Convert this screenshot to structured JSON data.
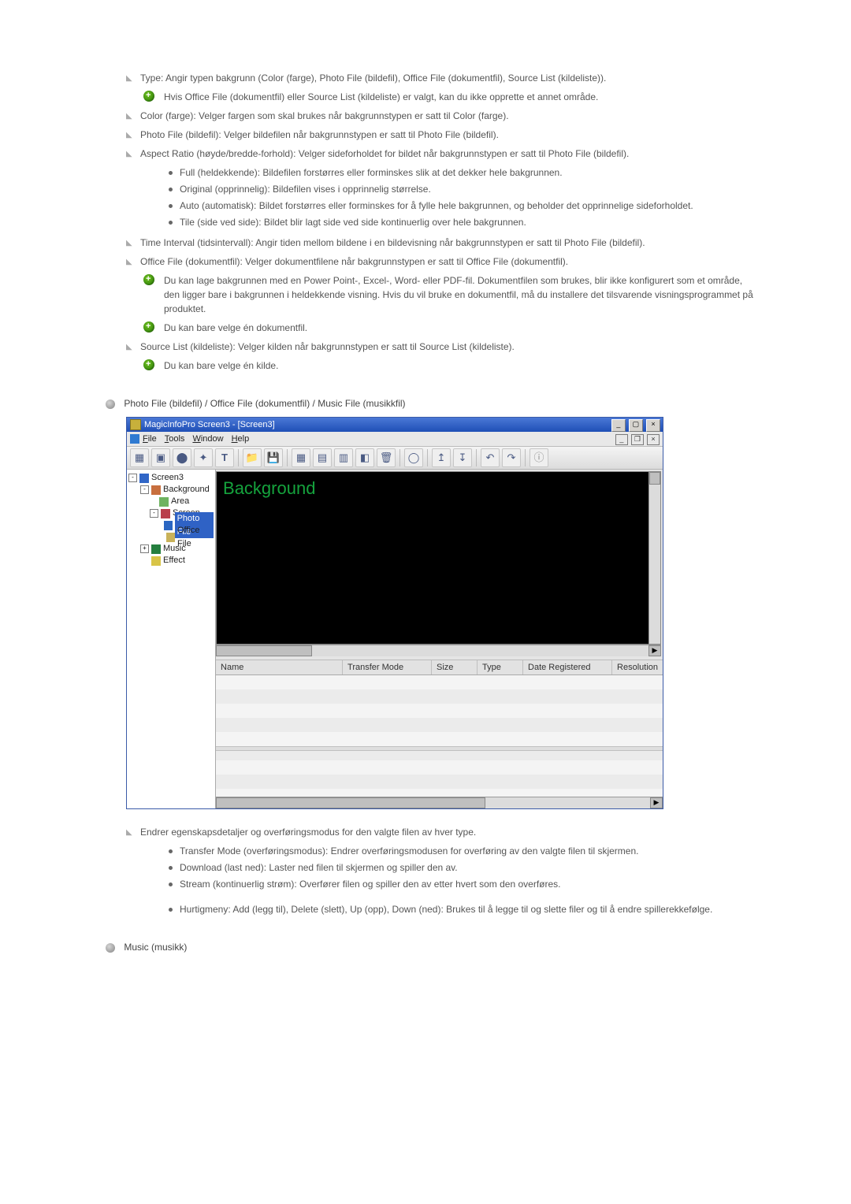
{
  "items": {
    "type_line": "Type: Angir typen bakgrunn (Color (farge), Photo File (bildefil), Office File (dokumentfil), Source List (kildeliste)).",
    "type_note": "Hvis Office File (dokumentfil) eller Source List (kildeliste) er valgt, kan du ikke opprette et annet område.",
    "color_line": "Color (farge): Velger fargen som skal brukes når bakgrunnstypen er satt til Color (farge).",
    "photo_line": "Photo File (bildefil): Velger bildefilen når bakgrunnstypen er satt til Photo File (bildefil).",
    "aspect_line": "Aspect Ratio (høyde/bredde-forhold): Velger sideforholdet for bildet når bakgrunnstypen er satt til Photo File (bildefil).",
    "aspect_subs": [
      "Full (heldekkende): Bildefilen forstørres eller forminskes slik at det dekker hele bakgrunnen.",
      "Original (opprinnelig): Bildefilen vises i opprinnelig størrelse.",
      "Auto (automatisk): Bildet forstørres eller forminskes for å fylle hele bakgrunnen, og beholder det opprinnelige sideforholdet.",
      "Tile (side ved side): Bildet blir lagt side ved side kontinuerlig over hele bakgrunnen."
    ],
    "time_line": "Time Interval (tidsintervall): Angir tiden mellom bildene i en bildevisning når bakgrunnstypen er satt til Photo File (bildefil).",
    "office_line": "Office File (dokumentfil): Velger dokumentfilene når bakgrunnstypen er satt til Office File (dokumentfil).",
    "office_note1": "Du kan lage bakgrunnen med en Power Point-, Excel-, Word- eller PDF-fil. Dokumentfilen som brukes, blir ikke konfigurert som et område, den ligger bare i bakgrunnen i heldekkende visning. Hvis du vil bruke en dokumentfil, må du installere det tilsvarende visningsprogrammet på produktet.",
    "office_note2": "Du kan bare velge én dokumentfil.",
    "source_line": "Source List (kildeliste): Velger kilden når bakgrunnstypen er satt til Source List (kildeliste).",
    "source_note": "Du kan bare velge én kilde."
  },
  "section2_title": "Photo File (bildefil) / Office File (dokumentfil) / Music File (musikkfil)",
  "app": {
    "title": "MagicInfoPro Screen3 - [Screen3]",
    "menu": {
      "file": "File",
      "tools": "Tools",
      "window": "Window",
      "help": "Help"
    },
    "tree": {
      "root": "Screen3",
      "background": "Background",
      "area": "Area",
      "screen": "Screen",
      "photo": "Photo File",
      "office": "Office File",
      "music": "Music",
      "effect": "Effect"
    },
    "canvas_label": "Background",
    "grid": {
      "name": "Name",
      "transfer": "Transfer Mode",
      "size": "Size",
      "type": "Type",
      "date": "Date Registered",
      "resolution": "Resolution"
    }
  },
  "post": {
    "change_line": "Endrer egenskapsdetaljer og overføringsmodus for den valgte filen av hver type.",
    "subs": [
      "Transfer Mode (overføringsmodus): Endrer overføringsmodusen for overføring av den valgte filen til skjermen.",
      "Download (last ned): Laster ned filen til skjermen og spiller den av.",
      "Stream (kontinuerlig strøm): Overfører filen og spiller den av etter hvert som den overføres."
    ],
    "quick": "Hurtigmeny: Add (legg til), Delete (slett), Up (opp), Down (ned): Brukes til å legge til og slette filer og til å endre spillerekkefølge."
  },
  "section3_title": "Music (musikk)"
}
